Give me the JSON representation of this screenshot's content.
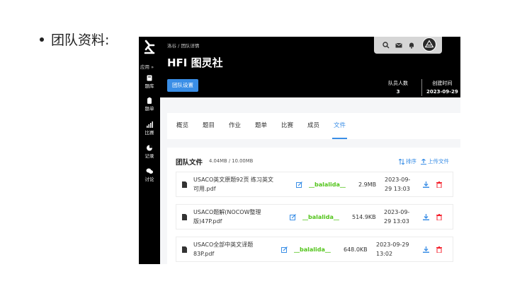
{
  "slide": {
    "bullet_text": "团队资料:"
  },
  "sidebar": {
    "toggle_label": "应用 »",
    "items": [
      {
        "label": "题库",
        "icon": "book-icon"
      },
      {
        "label": "题单",
        "icon": "clipboard-icon"
      },
      {
        "label": "比赛",
        "icon": "bar-chart-icon"
      },
      {
        "label": "记录",
        "icon": "pie-chart-icon"
      },
      {
        "label": "讨论",
        "icon": "chat-icon"
      }
    ]
  },
  "header": {
    "breadcrumb": "洛谷 / 团队详情",
    "team_name": "HFI 图灵社",
    "settings_button": "团队设置",
    "stats": [
      {
        "label": "队员人数",
        "value": "3"
      },
      {
        "label": "创建时间",
        "value": "2023-09-29"
      }
    ]
  },
  "tabs": [
    "概览",
    "题目",
    "作业",
    "题单",
    "比赛",
    "成员",
    "文件"
  ],
  "active_tab": "文件",
  "files_panel": {
    "title": "团队文件",
    "usage": "4.04MB / 10.00MB",
    "sort_label": "排序",
    "upload_label": "上传文件",
    "files": [
      {
        "name_line1": "USACO英文原题92页 练习英文",
        "name_line2": "可用.pdf",
        "uploader": "__balalida__",
        "size": "2.9MB",
        "date_line1": "2023-09-",
        "date_line2": "29 13:03"
      },
      {
        "name_line1": "USACO题解(NOCOW整理",
        "name_line2": "版)47P.pdf",
        "uploader": "__balalida__",
        "size": "514.9KB",
        "date_line1": "2023-09-",
        "date_line2": "29 13:03"
      },
      {
        "name_line1": "USACO全部中英文译题",
        "name_line2": "83P.pdf",
        "uploader": "__balalida__",
        "size": "648.0KB",
        "date_line1": "2023-09-29",
        "date_line2": "13:02"
      }
    ]
  },
  "colors": {
    "accent": "#3a8ee6",
    "uploader": "#52c41a",
    "danger": "#f5222d",
    "header_bg": "#000000"
  }
}
